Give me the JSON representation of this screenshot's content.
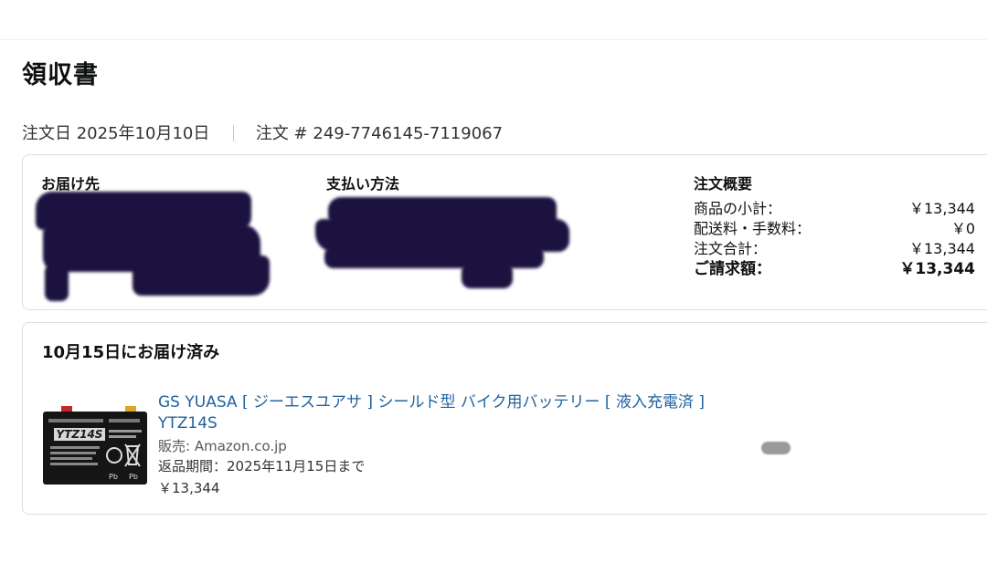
{
  "page": {
    "title": "領収書"
  },
  "order": {
    "date_label": "注文日",
    "date": "2025年10月10日",
    "number_label": "注文 #",
    "number": "249-7746145-7119067"
  },
  "summary": {
    "shipping_to_label": "お届け先",
    "payment_label": "支払い方法",
    "overview_label": "注文概要",
    "rows": [
      {
        "label": "商品の小計：",
        "value": "￥13,344"
      },
      {
        "label": "配送料・手数料：",
        "value": "￥0"
      },
      {
        "label": "注文合計：",
        "value": "￥13,344"
      },
      {
        "label": "ご請求額：",
        "value": "￥13,344"
      }
    ]
  },
  "delivery": {
    "status": "10月15日にお届け済み",
    "item": {
      "title": "GS YUASA [ ジーエスユアサ ] シールド型 バイク用バッテリー [ 液入充電済 ] YTZ14S",
      "seller": "販売: Amazon.co.jp",
      "return_period": "返品期間：2025年11月15日まで",
      "price": "￥13,344",
      "image_label": "YTZ14S"
    }
  }
}
